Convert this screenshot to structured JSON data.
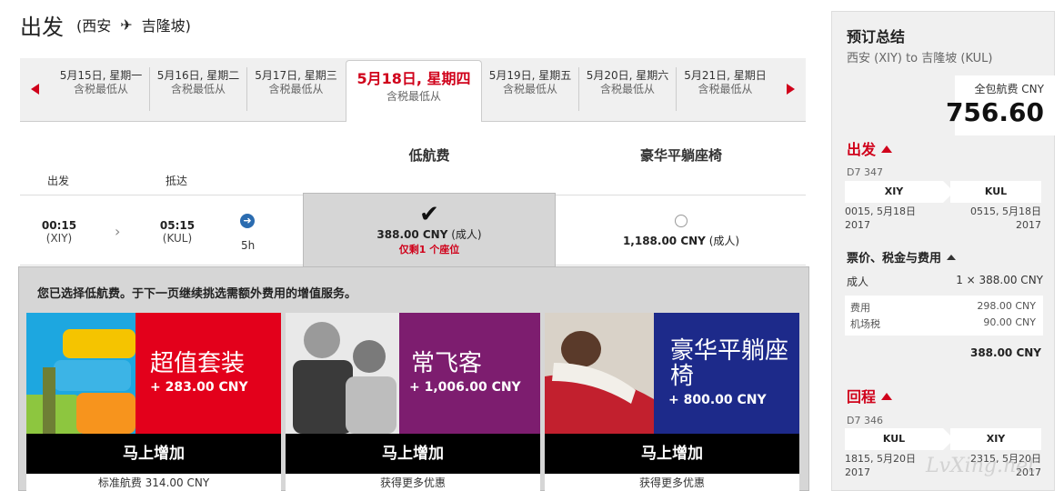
{
  "header": {
    "title": "出发",
    "origin": "(西安",
    "destination": "吉隆坡)"
  },
  "datebar": {
    "days": [
      {
        "date": "5月15日, 星期一",
        "sub": "含税最低从"
      },
      {
        "date": "5月16日, 星期二",
        "sub": "含税最低从"
      },
      {
        "date": "5月17日, 星期三",
        "sub": "含税最低从"
      },
      {
        "date": "5月18日, 星期四",
        "sub": "含税最低从"
      },
      {
        "date": "5月19日, 星期五",
        "sub": "含税最低从"
      },
      {
        "date": "5月20日, 星期六",
        "sub": "含税最低从"
      },
      {
        "date": "5月21日, 星期日",
        "sub": "含税最低从"
      }
    ]
  },
  "fares": {
    "low_label": "低航费",
    "premium_label": "豪华平躺座椅",
    "depart_col": "出发",
    "arrive_col": "抵达"
  },
  "flight": {
    "depart_time": "00:15",
    "depart_code": "(XIY)",
    "arrive_time": "05:15",
    "arrive_code": "(KUL)",
    "duration": "5h",
    "low_price": "388.00 CNY",
    "low_unit": " (成人)",
    "low_seats": "仅剩1 个座位",
    "premium_price": "1,188.00 CNY",
    "premium_unit": " (成人)"
  },
  "upsell": {
    "message": "您已选择低航费。于下一页继续挑选需额外费用的增值服务。",
    "cards": [
      {
        "title": "超值套装",
        "price": "+ 283.00 CNY",
        "button": "马上增加",
        "foot": "标准航费 314.00 CNY",
        "color": "#e3001b"
      },
      {
        "title": "常飞客",
        "price": "+ 1,006.00 CNY",
        "button": "马上增加",
        "foot": "获得更多优惠",
        "color": "#7d1d6f"
      },
      {
        "title": "豪华平躺座椅",
        "price": "+ 800.00 CNY",
        "button": "马上增加",
        "foot": "获得更多优惠",
        "color": "#1d2a8a"
      }
    ]
  },
  "summary": {
    "title": "预订总结",
    "route": "西安 (XIY) to 吉隆坡 (KUL)",
    "total_label": "全包航费 CNY",
    "total_value": "756.60",
    "outbound": {
      "label": "出发",
      "flight_no": "D7 347",
      "from": "XIY",
      "to": "KUL",
      "dep": "0015, 5月18日",
      "dep_year": "2017",
      "arr": "0515, 5月18日",
      "arr_year": "2017"
    },
    "pricing_label": "票价、税金与费用",
    "adult_label": "成人",
    "adult_value": "1 × 388.00 CNY",
    "fee_label": "费用",
    "fee_value": "298.00 CNY",
    "tax_label": "机场税",
    "tax_value": "90.00 CNY",
    "subtotal": "388.00 CNY",
    "return": {
      "label": "回程",
      "flight_no": "D7 346",
      "from": "KUL",
      "to": "XIY",
      "dep": "1815, 5月20日",
      "dep_year": "2017",
      "arr": "2315, 5月20日",
      "arr_year": "2017"
    },
    "watermark": "LvXing.net"
  }
}
